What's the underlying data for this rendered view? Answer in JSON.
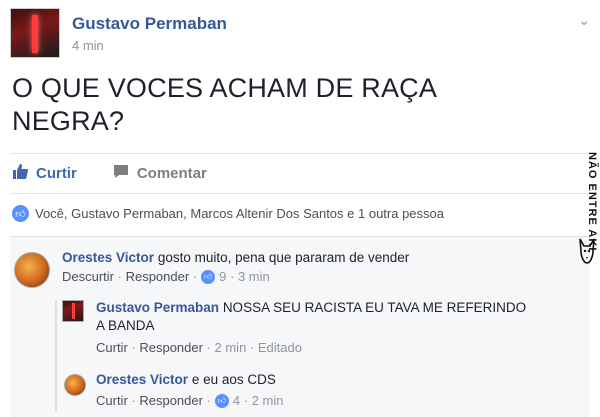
{
  "post": {
    "author": "Gustavo Permaban",
    "time": "4 min",
    "text_line1": "O QUE VOCES ACHAM DE RAÇA",
    "text_line2": "NEGRA?"
  },
  "actions": {
    "like_label": "Curtir",
    "comment_label": "Comentar"
  },
  "reactions": {
    "summary": "Você, Gustavo Permaban, Marcos Altenir Dos Santos e 1 outra pessoa"
  },
  "comments": [
    {
      "author": "Orestes Victor",
      "text": "gosto muito, pena que pararam de vender",
      "action1": "Descurtir",
      "action2": "Responder",
      "likes": "9",
      "time": "3 min"
    }
  ],
  "replies": [
    {
      "author": "Gustavo Permaban",
      "text_line1": "NOSSA SEU RACISTA EU TAVA ME REFERINDO",
      "text_line2": "A BANDA",
      "action1": "Curtir",
      "action2": "Responder",
      "time": "2 min",
      "edited": "Editado"
    },
    {
      "author": "Orestes Victor",
      "text": "e eu aos CDS",
      "action1": "Curtir",
      "action2": "Responder",
      "likes": "4",
      "time": "2 min"
    }
  ],
  "watermark": {
    "text": "NÃO ENTRE AKI"
  },
  "colors": {
    "link_blue": "#365899",
    "like_blue": "#4267b2",
    "meta_gray": "#90949c"
  }
}
